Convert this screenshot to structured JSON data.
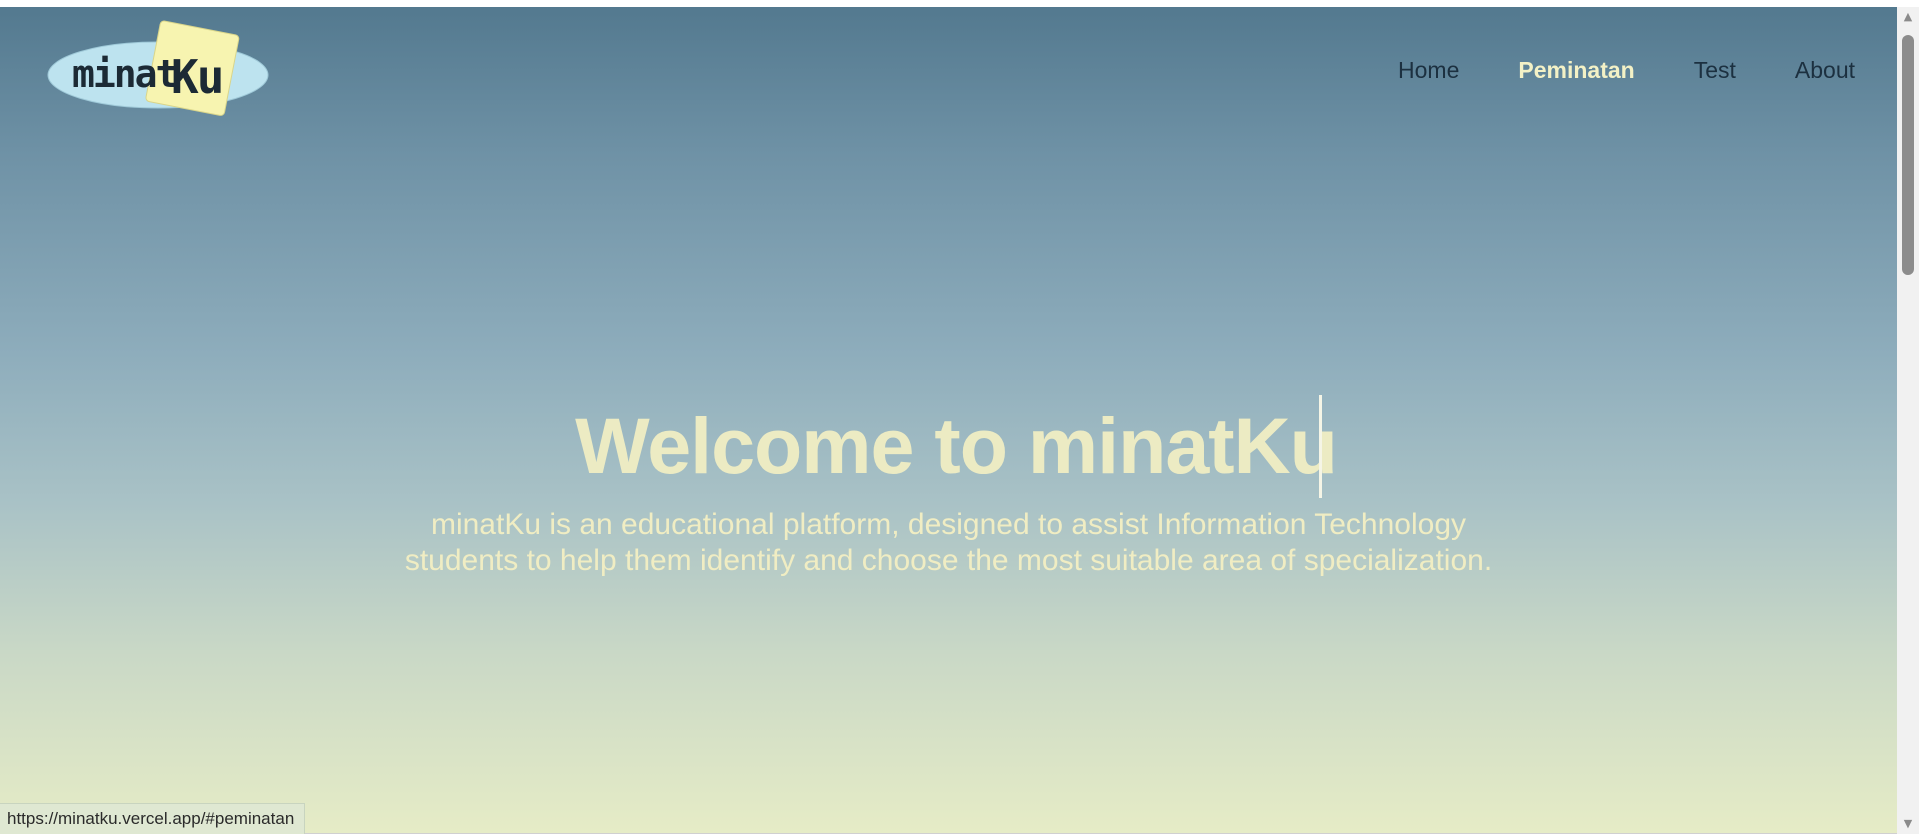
{
  "brand": {
    "logo_text": "minatKu",
    "colors": {
      "ellipse": "#bde3ef",
      "note": "#f7f4b0",
      "ink": "#1c2a35"
    }
  },
  "nav": {
    "items": [
      {
        "label": "Home",
        "active": false
      },
      {
        "label": "Peminatan",
        "active": true
      },
      {
        "label": "Test",
        "active": false
      },
      {
        "label": "About",
        "active": false
      }
    ]
  },
  "hero": {
    "title": "Welcome to minatKu",
    "description": "minatKu is an educational platform, designed to assist Information Technology students to help them identify and choose the most suitable area of specialization."
  },
  "status_bar": {
    "url": "https://minatku.vercel.app/#peminatan"
  },
  "colors": {
    "gradient_top": "#53798f",
    "gradient_bottom": "#e6ecc6",
    "hero_text": "#ecebc3",
    "nav_text": "#1c3040",
    "nav_active": "#f3f1c6"
  }
}
